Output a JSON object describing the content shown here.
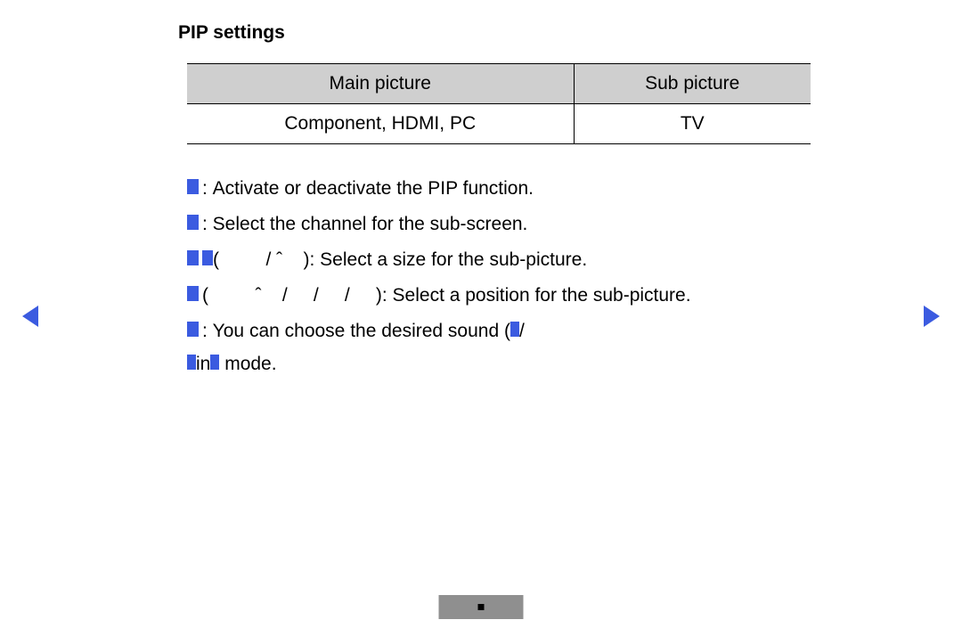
{
  "title": "PIP settings",
  "table": {
    "headers": {
      "main": "Main picture",
      "sub": "Sub picture"
    },
    "row": {
      "main": "Component, HDMI, PC",
      "sub": "TV"
    }
  },
  "lines": {
    "l1": "Activate or deactivate the PIP function.",
    "l2": "Select the channel for the sub-screen.",
    "l3_open": "(",
    "l3_sep": " / ˆ",
    "l3_rest": "): Select a size for the sub-picture.",
    "l4_open": "(",
    "l4_mid": "ˆ    /      /      /",
    "l4_rest": "): Select a position for the sub-picture.",
    "l5_a": "You can choose the desired sound (",
    "l5_slash": " / ",
    "l6_a": " in ",
    "l6_b": "mode."
  }
}
